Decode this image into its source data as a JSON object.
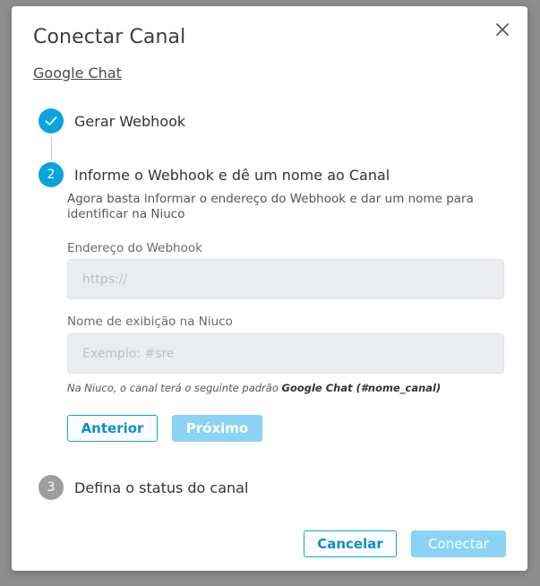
{
  "modal": {
    "title": "Conectar Canal",
    "subtitle": "Google Chat",
    "close_icon": "close-icon"
  },
  "steps": [
    {
      "number": "1",
      "label": "Gerar Webhook",
      "state": "completed",
      "icon": "check-icon"
    },
    {
      "number": "2",
      "label": "Informe o Webhook e dê um nome ao Canal",
      "state": "active"
    },
    {
      "number": "3",
      "label": "Defina o status do canal",
      "state": "pending"
    }
  ],
  "step2": {
    "description": "Agora basta informar o endereço do Webhook e dar um nome para identificar na Niuco",
    "webhook": {
      "label": "Endereço do Webhook",
      "placeholder": "https://",
      "value": ""
    },
    "display_name": {
      "label": "Nome de exibição na Niuco",
      "placeholder": "Exemplo: #sre",
      "value": ""
    },
    "hint_prefix": "Na Niuco, o canal terá o seguinte padrão ",
    "hint_bold": "Google Chat (#nome_canal)",
    "back_label": "Anterior",
    "next_label": "Próximo"
  },
  "footer": {
    "cancel_label": "Cancelar",
    "connect_label": "Conectar"
  },
  "colors": {
    "accent": "#0aa3e0",
    "accent_disabled": "#8ad3f5",
    "step_pending": "#9e9e9e"
  }
}
